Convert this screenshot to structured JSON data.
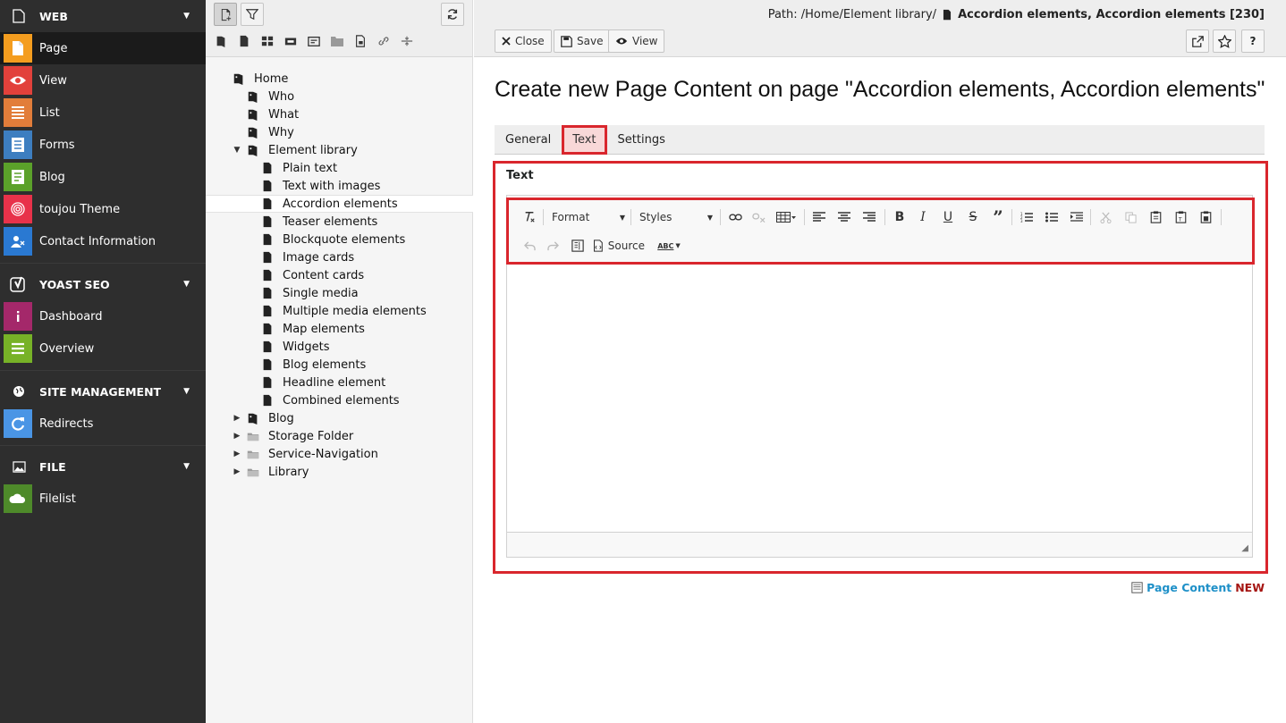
{
  "modules": {
    "groups": [
      {
        "label": "WEB",
        "icon": "page-icon",
        "items": [
          {
            "label": "Page",
            "icon": "page-icon",
            "color": "#f49d1f"
          },
          {
            "label": "View",
            "icon": "eye-icon",
            "color": "#e2413b"
          },
          {
            "label": "List",
            "icon": "list-icon",
            "color": "#e27d3a"
          },
          {
            "label": "Forms",
            "icon": "forms-icon",
            "color": "#3d7ec0"
          },
          {
            "label": "Blog",
            "icon": "blog-icon",
            "color": "#5ba12a"
          },
          {
            "label": "toujou Theme",
            "icon": "fingerprint-icon",
            "color": "#e8324a"
          },
          {
            "label": "Contact Information",
            "icon": "contact-icon",
            "color": "#2a79d2"
          }
        ]
      },
      {
        "label": "YOAST SEO",
        "icon": "yoast-icon",
        "items": [
          {
            "label": "Dashboard",
            "icon": "info-icon",
            "color": "#a4286a"
          },
          {
            "label": "Overview",
            "icon": "lines-icon",
            "color": "#77b227"
          }
        ]
      },
      {
        "label": "SITE MANAGEMENT",
        "icon": "globe-icon",
        "items": [
          {
            "label": "Redirects",
            "icon": "redirect-icon",
            "color": "#4a95e5"
          }
        ]
      },
      {
        "label": "FILE",
        "icon": "image-icon",
        "items": [
          {
            "label": "Filelist",
            "icon": "cloud-icon",
            "color": "#4e8a2a"
          }
        ]
      }
    ]
  },
  "tree": {
    "nodes": [
      {
        "label": "Home",
        "depth": 0,
        "icon": "site-icon",
        "expand": ""
      },
      {
        "label": "Who",
        "depth": 1,
        "icon": "site-icon",
        "expand": ""
      },
      {
        "label": "What",
        "depth": 1,
        "icon": "site-icon",
        "expand": ""
      },
      {
        "label": "Why",
        "depth": 1,
        "icon": "site-icon",
        "expand": ""
      },
      {
        "label": "Element library",
        "depth": 1,
        "icon": "site-icon",
        "expand": "open"
      },
      {
        "label": "Plain text",
        "depth": 2,
        "icon": "page-icon",
        "expand": ""
      },
      {
        "label": "Text with images",
        "depth": 2,
        "icon": "page-icon",
        "expand": ""
      },
      {
        "label": "Accordion elements",
        "depth": 2,
        "icon": "page-icon",
        "expand": "",
        "selected": true
      },
      {
        "label": "Teaser elements",
        "depth": 2,
        "icon": "page-icon",
        "expand": ""
      },
      {
        "label": "Blockquote elements",
        "depth": 2,
        "icon": "page-icon",
        "expand": ""
      },
      {
        "label": "Image cards",
        "depth": 2,
        "icon": "page-icon",
        "expand": ""
      },
      {
        "label": "Content cards",
        "depth": 2,
        "icon": "page-icon",
        "expand": ""
      },
      {
        "label": "Single media",
        "depth": 2,
        "icon": "page-icon",
        "expand": ""
      },
      {
        "label": "Multiple media elements",
        "depth": 2,
        "icon": "page-icon",
        "expand": ""
      },
      {
        "label": "Map elements",
        "depth": 2,
        "icon": "page-icon",
        "expand": ""
      },
      {
        "label": "Widgets",
        "depth": 2,
        "icon": "page-icon",
        "expand": ""
      },
      {
        "label": "Blog elements",
        "depth": 2,
        "icon": "page-icon",
        "expand": ""
      },
      {
        "label": "Headline element",
        "depth": 2,
        "icon": "page-icon",
        "expand": ""
      },
      {
        "label": "Combined elements",
        "depth": 2,
        "icon": "page-icon",
        "expand": ""
      },
      {
        "label": "Blog",
        "depth": 1,
        "icon": "site-icon",
        "expand": "closed"
      },
      {
        "label": "Storage Folder",
        "depth": 1,
        "icon": "folder-icon",
        "expand": "closed"
      },
      {
        "label": "Service-Navigation",
        "depth": 1,
        "icon": "folder-icon",
        "expand": "closed"
      },
      {
        "label": "Library",
        "depth": 1,
        "icon": "folder-icon",
        "expand": "closed"
      }
    ]
  },
  "header": {
    "path_prefix": "Path: /Home/Element library/",
    "path_page": "Accordion elements, Accordion elements [230]",
    "close_label": "Close",
    "save_label": "Save",
    "view_label": "View",
    "help_label": "?"
  },
  "page_title": "Create new Page Content on page \"Accordion elements, Accordion elements\"",
  "tabs": [
    {
      "label": "General"
    },
    {
      "label": "Text",
      "active": true
    },
    {
      "label": "Settings"
    }
  ],
  "field": {
    "label": "Text"
  },
  "editor": {
    "format_label": "Format",
    "styles_label": "Styles",
    "source_label": "Source",
    "spell_label": "ABC"
  },
  "record_type": {
    "prefix": "Page Content",
    "state": "NEW"
  },
  "colors": {
    "accent_red": "#d9262d",
    "link_blue": "#1e90c8",
    "new_red": "#a51512"
  }
}
